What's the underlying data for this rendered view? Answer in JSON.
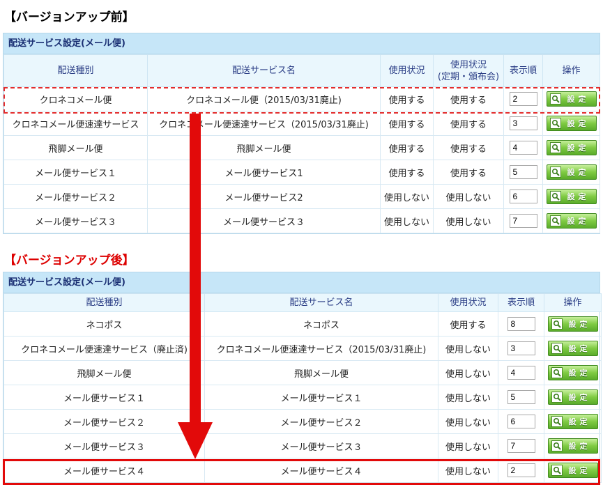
{
  "before": {
    "heading": "【バージョンアップ前】",
    "panel_title": "配送サービス設定(メール便)",
    "headers": {
      "type": "配送種別",
      "service": "配送サービス名",
      "status": "使用状況",
      "status_regular_line1": "使用状況",
      "status_regular_line2": "(定期・頒布会)",
      "order": "表示順",
      "action": "操作"
    },
    "rows": [
      {
        "type": "クロネコメール便",
        "service": "クロネコメール便（2015/03/31廃止)",
        "status": "使用する",
        "status_regular": "使用する",
        "order": "2"
      },
      {
        "type": "クロネコメール便速達サービス",
        "service": "クロネコメール便速達サービス（2015/03/31廃止)",
        "status": "使用する",
        "status_regular": "使用する",
        "order": "3"
      },
      {
        "type": "飛脚メール便",
        "service": "飛脚メール便",
        "status": "使用する",
        "status_regular": "使用する",
        "order": "4"
      },
      {
        "type": "メール便サービス１",
        "service": "メール便サービス1",
        "status": "使用する",
        "status_regular": "使用する",
        "order": "5"
      },
      {
        "type": "メール便サービス２",
        "service": "メール便サービス2",
        "status": "使用しない",
        "status_regular": "使用しない",
        "order": "6"
      },
      {
        "type": "メール便サービス３",
        "service": "メール便サービス３",
        "status": "使用しない",
        "status_regular": "使用しない",
        "order": "7"
      }
    ]
  },
  "after": {
    "heading": "【バージョンアップ後】",
    "panel_title": "配送サービス設定(メール便)",
    "headers": {
      "type": "配送種別",
      "service": "配送サービス名",
      "status": "使用状況",
      "order": "表示順",
      "action": "操作"
    },
    "rows": [
      {
        "type": "ネコポス",
        "service": "ネコポス",
        "status": "使用する",
        "order": "8"
      },
      {
        "type": "クロネコメール便速達サービス（廃止済)",
        "service": "クロネコメール便速達サービス（2015/03/31廃止)",
        "status": "使用しない",
        "order": "3"
      },
      {
        "type": "飛脚メール便",
        "service": "飛脚メール便",
        "status": "使用しない",
        "order": "4"
      },
      {
        "type": "メール便サービス１",
        "service": "メール便サービス１",
        "status": "使用しない",
        "order": "5"
      },
      {
        "type": "メール便サービス２",
        "service": "メール便サービス２",
        "status": "使用しない",
        "order": "6"
      },
      {
        "type": "メール便サービス３",
        "service": "メール便サービス３",
        "status": "使用しない",
        "order": "7"
      },
      {
        "type": "メール便サービス４",
        "service": "メール便サービス４",
        "status": "使用しない",
        "order": "2"
      }
    ]
  },
  "button_label": "設定",
  "icons": {
    "button_icon": "wrench-magnifier-icon",
    "arrow": "down-arrow-icon"
  },
  "colors": {
    "accent_red": "#e20a0a",
    "panel_title_bg": "#c6e6f8",
    "header_bg": "#eaf7fd",
    "button_green": "#6fbd3a"
  }
}
